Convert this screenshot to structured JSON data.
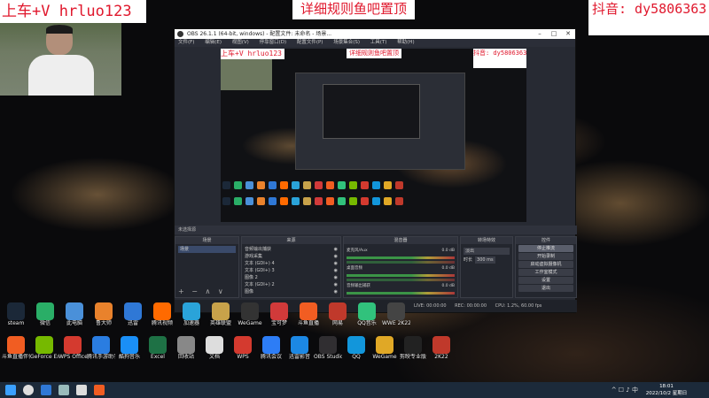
{
  "overlays": {
    "left": "上车+V hrluo123",
    "center": "详细规则鱼吧置顶",
    "right": "抖音: dy5806363"
  },
  "obs": {
    "title": "OBS 26.1.1 (64-bit, windows) - 配置文件: 未命名 - 场景...",
    "menu": [
      "文件(F)",
      "编辑(E)",
      "视图(V)",
      "停靠窗口(D)",
      "配置文件(P)",
      "场景集合(S)",
      "工具(T)",
      "帮助(H)"
    ],
    "preview_overlays": {
      "left": "上车+V hrluo123",
      "center": "详细规则鱼吧置顶",
      "right": "抖音: dy5806363"
    },
    "status_strip": "未选择源",
    "docks": {
      "scenes": {
        "title": "场景",
        "items": [
          "场景"
        ]
      },
      "sources": {
        "title": "来源",
        "items": [
          "音频输出捕获",
          "游戏采集",
          "文本 (GDI+) 4",
          "文本 (GDI+) 3",
          "图像 2",
          "文本 (GDI+) 2",
          "图像"
        ]
      },
      "mixer": {
        "title": "混音器",
        "rows": [
          {
            "name": "麦克风/Aux",
            "db": "0.0 dB"
          },
          {
            "name": "桌面音频",
            "db": "0.0 dB"
          },
          {
            "name": "音频输出捕获",
            "db": "0.0 dB"
          }
        ]
      },
      "transitions": {
        "title": "转场特效",
        "type": "淡出",
        "duration_label": "时长",
        "duration": "300 ms"
      },
      "controls": {
        "title": "控件",
        "buttons": [
          "停止推流",
          "开始录制",
          "启动虚拟摄像机",
          "工作室模式",
          "设置",
          "退出"
        ]
      }
    },
    "status": {
      "live": "LIVE: 00:00:00",
      "rec": "REC: 00:00:00",
      "cpu": "CPU: 1.2%, 60.00 fps"
    }
  },
  "desktop_icons_row1": [
    {
      "label": "steam",
      "color": "#1b2838"
    },
    {
      "label": "微信",
      "color": "#2aae67"
    },
    {
      "label": "此电脑",
      "color": "#4a90d9"
    },
    {
      "label": "鲁大师",
      "color": "#e9822c"
    },
    {
      "label": "迅雷",
      "color": "#2f78d6"
    },
    {
      "label": "腾讯视频",
      "color": "#ff6a00"
    },
    {
      "label": "加速器",
      "color": "#2aa3d9"
    },
    {
      "label": "英雄联盟",
      "color": "#c8a24a"
    },
    {
      "label": "WeGame",
      "color": "#333"
    },
    {
      "label": "宝可梦",
      "color": "#d13a3a"
    },
    {
      "label": "斗鱼直播",
      "color": "#f15d22"
    },
    {
      "label": "网易",
      "color": "#c0392b"
    },
    {
      "label": "QQ音乐",
      "color": "#31c27c"
    },
    {
      "label": "WWE 2K22",
      "color": "#444"
    }
  ],
  "desktop_icons_row2": [
    {
      "label": "斗鱼直播伴侣",
      "color": "#f15d22"
    },
    {
      "label": "GeForce Experience",
      "color": "#76b900"
    },
    {
      "label": "WPS Office",
      "color": "#d43a2f"
    },
    {
      "label": "腾讯手游助手",
      "color": "#2a7de1"
    },
    {
      "label": "酷狗音乐",
      "color": "#1a8ff7"
    },
    {
      "label": "Excel",
      "color": "#1e7145"
    },
    {
      "label": "回收站",
      "color": "#888"
    },
    {
      "label": "文档",
      "color": "#ddd"
    },
    {
      "label": "WPS",
      "color": "#d43a2f"
    },
    {
      "label": "腾讯会议",
      "color": "#2d7df6"
    },
    {
      "label": "迅雷影音",
      "color": "#1c88e4"
    },
    {
      "label": "OBS Studio",
      "color": "#302e31"
    },
    {
      "label": "QQ",
      "color": "#1296db"
    },
    {
      "label": "WeGame",
      "color": "#e0a826"
    },
    {
      "label": "剪映专业版",
      "color": "#222"
    },
    {
      "label": "2K22",
      "color": "#c0392b"
    }
  ],
  "taskbar": {
    "clock_time": "18:01",
    "clock_date": "2022/10/2 星期日",
    "apps": [
      {
        "name": "start",
        "color": "#3aa0ff"
      },
      {
        "name": "search",
        "color": "#ddd"
      },
      {
        "name": "browser",
        "color": "#2f78d6"
      },
      {
        "name": "steam",
        "color": "#9bb"
      },
      {
        "name": "obs",
        "color": "#ddd"
      },
      {
        "name": "douyu",
        "color": "#f15d22"
      }
    ]
  }
}
